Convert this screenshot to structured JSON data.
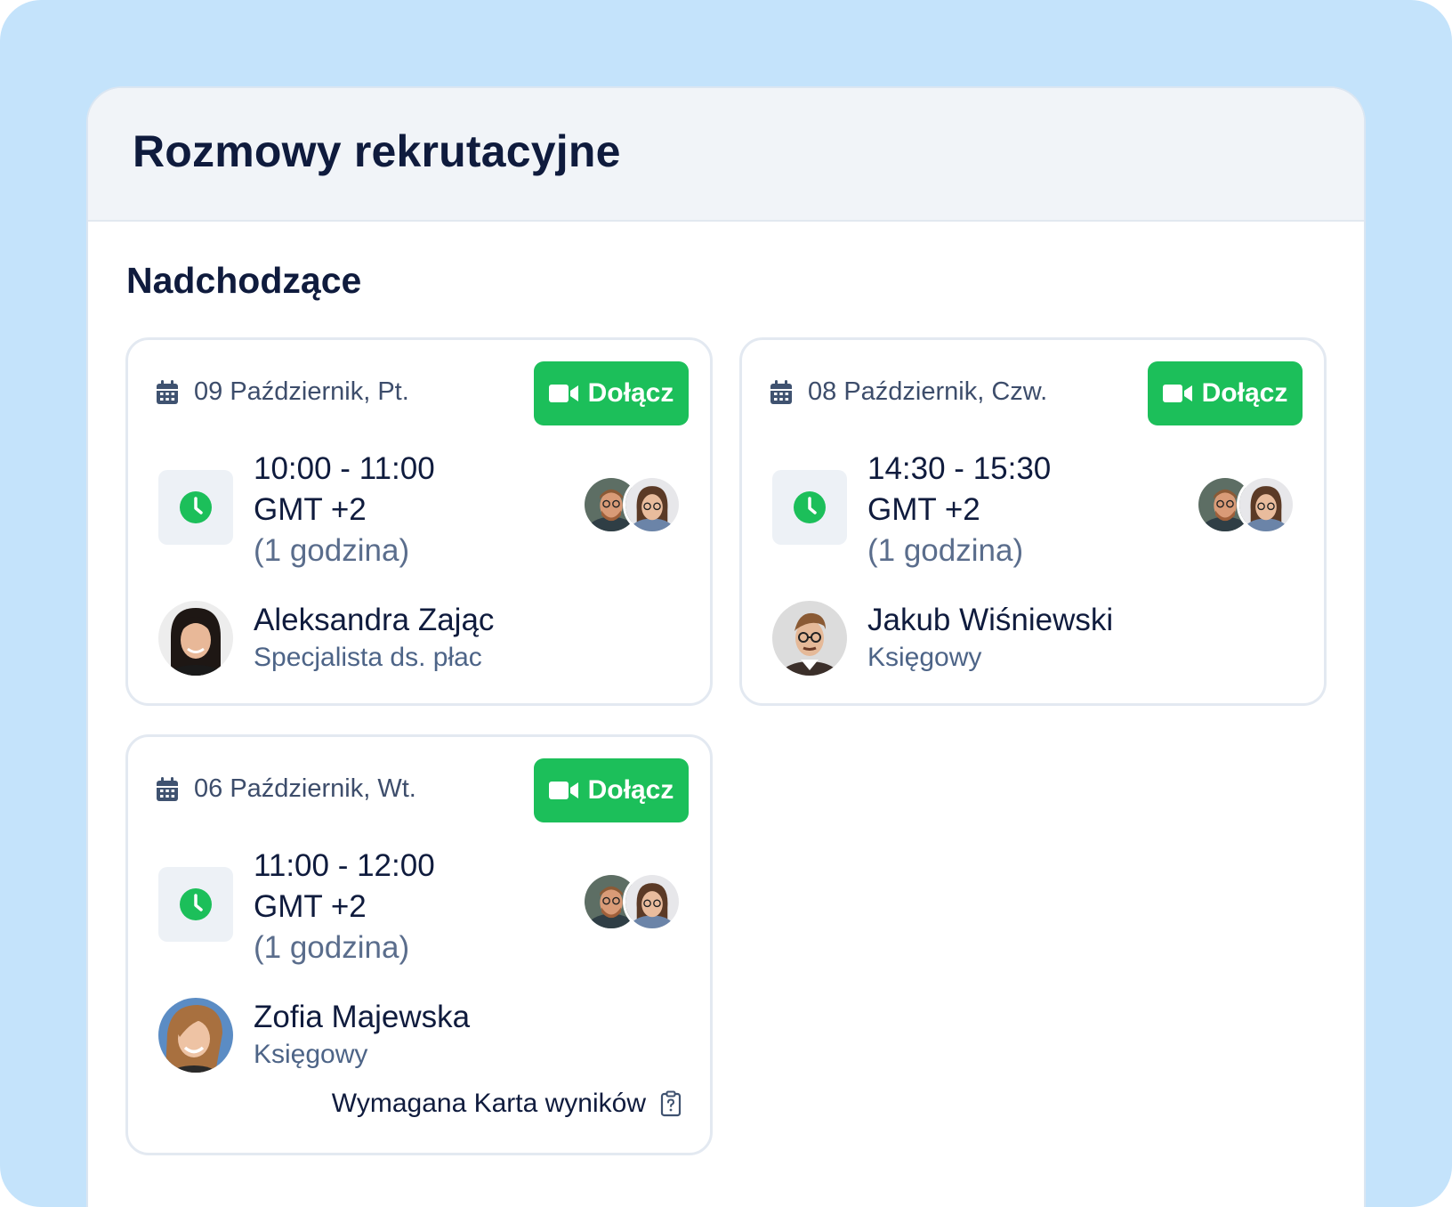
{
  "panel": {
    "title": "Rozmowy rekrutacyjne",
    "section_title": "Nadchodzące"
  },
  "colors": {
    "background": "#c4e3fb",
    "accent_green": "#1cbf5a",
    "text_dark": "#0f1b3d",
    "text_muted": "#4d6487",
    "header_bg": "#f1f4f8"
  },
  "icons": {
    "calendar": "calendar-icon",
    "video": "video-camera-icon",
    "clock": "clock-icon",
    "scorecard": "clipboard-question-icon"
  },
  "interviews": [
    {
      "date": "09 Październik, Pt.",
      "join_label": "Dołącz",
      "time_range": "10:00 - 11:00",
      "timezone": "GMT +2",
      "duration": "(1 godzina)",
      "candidate_name": "Aleksandra Zając",
      "candidate_role": "Specjalista ds. płac"
    },
    {
      "date": "08 Październik, Czw.",
      "join_label": "Dołącz",
      "time_range": "14:30 - 15:30",
      "timezone": "GMT +2",
      "duration": "(1 godzina)",
      "candidate_name": "Jakub Wiśniewski",
      "candidate_role": "Księgowy"
    },
    {
      "date": "06 Październik, Wt.",
      "join_label": "Dołącz",
      "time_range": "11:00 - 12:00",
      "timezone": "GMT +2",
      "duration": "(1 godzina)",
      "candidate_name": "Zofia Majewska",
      "candidate_role": "Księgowy",
      "scorecard_label": "Wymagana Karta wyników"
    }
  ]
}
